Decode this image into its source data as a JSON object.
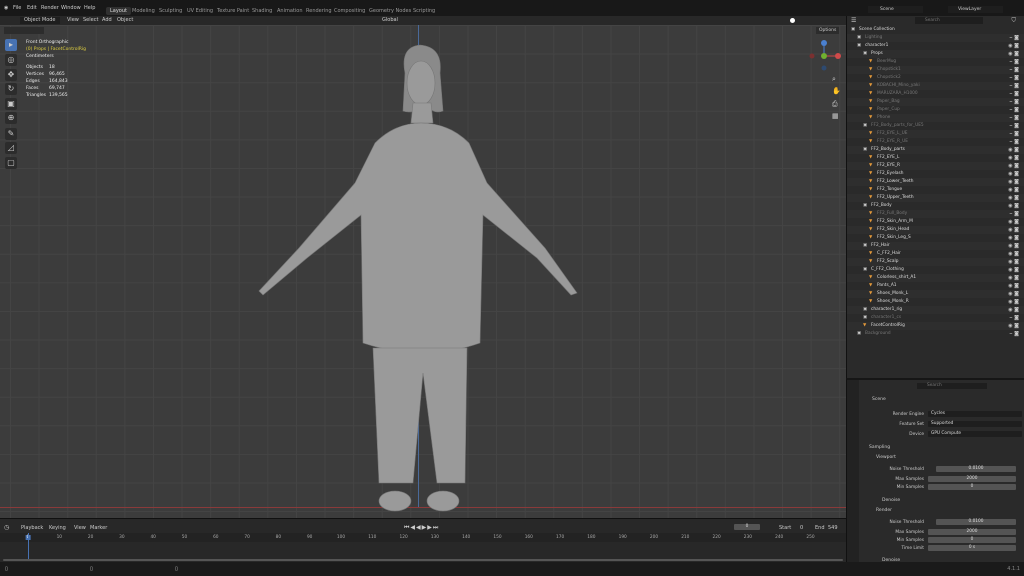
{
  "menu": [
    "File",
    "Edit",
    "Render",
    "Window",
    "Help"
  ],
  "workspaces": [
    "Layout",
    "Modeling",
    "Sculpting",
    "UV Editing",
    "Texture Paint",
    "Shading",
    "Animation",
    "Rendering",
    "Compositing",
    "Geometry Nodes",
    "Scripting"
  ],
  "active_workspace": "Layout",
  "scene": "Scene",
  "view_layer": "ViewLayer",
  "viewport_header": {
    "mode": "Object Mode",
    "items": [
      "View",
      "Select",
      "Add",
      "Object"
    ],
    "orientation": "Global",
    "options": "Options"
  },
  "overlay": {
    "view": "Front Orthographic",
    "context": "(0) Props | FacetControlRig",
    "units": "Centimeters",
    "stats": [
      [
        "Objects",
        "18"
      ],
      [
        "Vertices",
        "96,465"
      ],
      [
        "Edges",
        "164,843"
      ],
      [
        "Faces",
        "69,747"
      ],
      [
        "Triangles",
        "139,565"
      ]
    ]
  },
  "outliner": {
    "search_placeholder": "Search",
    "rows": [
      {
        "name": "Scene Collection",
        "d": 0,
        "c": 1
      },
      {
        "name": "Lighting",
        "d": 1,
        "c": 1,
        "dim": 1
      },
      {
        "name": "character1",
        "d": 1,
        "c": 1
      },
      {
        "name": "Props",
        "d": 2,
        "c": 1
      },
      {
        "name": "BeerMug",
        "d": 3,
        "dim": 1
      },
      {
        "name": "Chopstick1",
        "d": 3,
        "dim": 1
      },
      {
        "name": "Chopstick2",
        "d": 3,
        "dim": 1
      },
      {
        "name": "KOBACHI_Mino_yaki",
        "d": 3,
        "dim": 1
      },
      {
        "name": "MARUZARA_H1000",
        "d": 3,
        "dim": 1
      },
      {
        "name": "Paper_Bag",
        "d": 3,
        "dim": 1
      },
      {
        "name": "Paper_Cup",
        "d": 3,
        "dim": 1
      },
      {
        "name": "Phone",
        "d": 3,
        "dim": 1
      },
      {
        "name": "FF2_Body_parts_for_UE5",
        "d": 2,
        "c": 1,
        "dim": 1
      },
      {
        "name": "FF2_EYE_L_UE",
        "d": 3,
        "dim": 1
      },
      {
        "name": "FF2_EYE_R_UE",
        "d": 3,
        "dim": 1
      },
      {
        "name": "FF2_Body_parts",
        "d": 2,
        "c": 1
      },
      {
        "name": "FF2_EYE_L",
        "d": 3
      },
      {
        "name": "FF2_EYE_R",
        "d": 3
      },
      {
        "name": "FF2_Eyelash",
        "d": 3
      },
      {
        "name": "FF2_Lower_Teeth",
        "d": 3
      },
      {
        "name": "FF2_Tongue",
        "d": 3
      },
      {
        "name": "FF2_Upper_Teeth",
        "d": 3
      },
      {
        "name": "FF2_Body",
        "d": 2,
        "c": 1
      },
      {
        "name": "FF2_Full_Body",
        "d": 3,
        "dim": 1
      },
      {
        "name": "FF2_Skin_Arm_M",
        "d": 3
      },
      {
        "name": "FF2_Skin_Head",
        "d": 3
      },
      {
        "name": "FF2_Skin_Leg_S",
        "d": 3
      },
      {
        "name": "FF2_Hair",
        "d": 2,
        "c": 1
      },
      {
        "name": "C_FF2_Hair",
        "d": 3
      },
      {
        "name": "FF2_Scalp",
        "d": 3
      },
      {
        "name": "C_FF2_Clothing",
        "d": 2,
        "c": 1
      },
      {
        "name": "Colorless_shirt_A1",
        "d": 3
      },
      {
        "name": "Pants_A1",
        "d": 3
      },
      {
        "name": "Shoes_Monk_L",
        "d": 3
      },
      {
        "name": "Shoes_Monk_R",
        "d": 3
      },
      {
        "name": "character1_rig",
        "d": 2,
        "c": 1
      },
      {
        "name": "character1_cs",
        "d": 2,
        "c": 1,
        "dim": 1
      },
      {
        "name": "FacetControlRig",
        "d": 2
      },
      {
        "name": "Background",
        "d": 1,
        "c": 1,
        "dim": 1
      }
    ]
  },
  "properties": {
    "search_placeholder": "Search",
    "context": "Scene",
    "render_engine_label": "Render Engine",
    "render_engine": "Cycles",
    "feature_set_label": "Feature Set",
    "feature_set": "Supported",
    "device_label": "Device",
    "device": "GPU Compute",
    "sampling": "Sampling",
    "viewport": "Viewport",
    "render": "Render",
    "denoise": "Denoise",
    "noise_threshold_label": "Noise Threshold",
    "max_samples_label": "Max Samples",
    "min_samples_label": "Min Samples",
    "time_limit_label": "Time Limit",
    "vp_noise": "0.0100",
    "vp_max": "2000",
    "vp_min": "0",
    "r_noise": "0.0100",
    "r_max": "2000",
    "r_min": "0",
    "r_time": "0 s"
  },
  "timeline": {
    "menus": [
      "Playback",
      "Keying",
      "View",
      "Marker"
    ],
    "current_frame": "0",
    "start_label": "Start",
    "start": "0",
    "end_label": "End",
    "end": "549",
    "ticks": [
      "0",
      "10",
      "20",
      "30",
      "40",
      "50",
      "60",
      "70",
      "80",
      "90",
      "100",
      "110",
      "120",
      "130",
      "140",
      "150",
      "160",
      "170",
      "180",
      "190",
      "200",
      "210",
      "220",
      "230",
      "240",
      "250"
    ]
  },
  "version": "4.1.1"
}
